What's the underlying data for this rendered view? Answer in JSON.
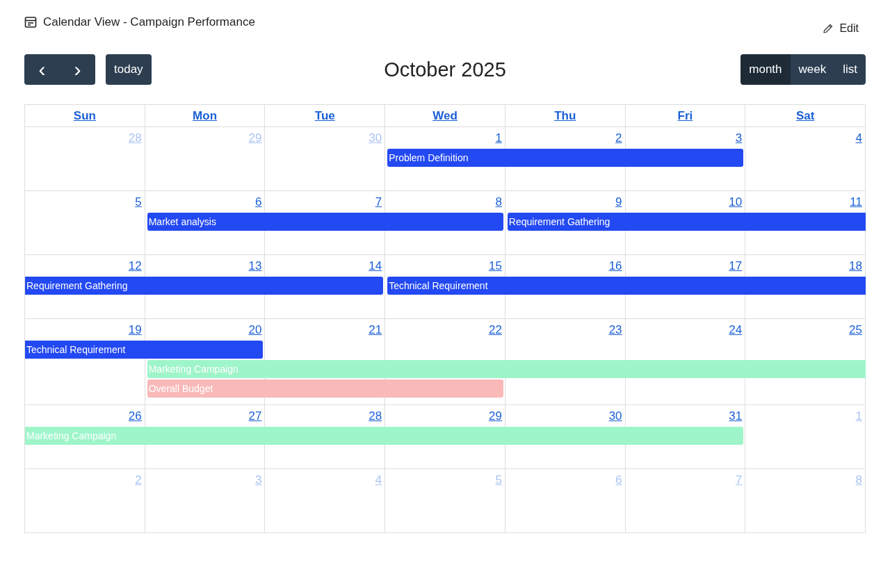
{
  "header": {
    "title": "Calendar View - Campaign Performance",
    "edit_label": "Edit"
  },
  "toolbar": {
    "prev": "‹",
    "next": "›",
    "today": "today",
    "title": "October 2025",
    "views": [
      {
        "label": "month",
        "selected": true
      },
      {
        "label": "week",
        "selected": false
      },
      {
        "label": "list",
        "selected": false
      }
    ]
  },
  "weekdays": [
    "Sun",
    "Mon",
    "Tue",
    "Wed",
    "Thu",
    "Fri",
    "Sat"
  ],
  "weeks": [
    {
      "days": [
        {
          "number": "28",
          "other_month": true
        },
        {
          "number": "29",
          "other_month": true
        },
        {
          "number": "30",
          "other_month": true
        },
        {
          "number": "1",
          "other_month": false
        },
        {
          "number": "2",
          "other_month": false
        },
        {
          "number": "3",
          "other_month": false
        },
        {
          "number": "4",
          "other_month": false
        }
      ],
      "events": [
        {
          "title": "Problem Definition",
          "covers": [
            false,
            false,
            false,
            true,
            true,
            true,
            false
          ],
          "color": "#2349f2",
          "continues_before": false,
          "continues_after": false
        }
      ]
    },
    {
      "days": [
        {
          "number": "5",
          "other_month": false
        },
        {
          "number": "6",
          "other_month": false
        },
        {
          "number": "7",
          "other_month": false
        },
        {
          "number": "8",
          "other_month": false
        },
        {
          "number": "9",
          "other_month": false
        },
        {
          "number": "10",
          "other_month": false
        },
        {
          "number": "11",
          "other_month": false
        }
      ],
      "events": [
        {
          "title": "Market analysis",
          "covers": [
            false,
            true,
            true,
            true,
            false,
            false,
            false
          ],
          "color": "#2349f2",
          "continues_before": false,
          "continues_after": false
        },
        {
          "title": "Requirement Gathering",
          "covers": [
            false,
            false,
            false,
            false,
            true,
            true,
            true
          ],
          "color": "#2349f2",
          "continues_before": false,
          "continues_after": true
        }
      ]
    },
    {
      "days": [
        {
          "number": "12",
          "other_month": false
        },
        {
          "number": "13",
          "other_month": false
        },
        {
          "number": "14",
          "other_month": false
        },
        {
          "number": "15",
          "other_month": false
        },
        {
          "number": "16",
          "other_month": false
        },
        {
          "number": "17",
          "other_month": false
        },
        {
          "number": "18",
          "other_month": false
        }
      ],
      "events": [
        {
          "title": "Requirement Gathering",
          "covers": [
            true,
            true,
            true,
            false,
            false,
            false,
            false
          ],
          "color": "#2349f2",
          "continues_before": true,
          "continues_after": false
        },
        {
          "title": "Technical Requirement",
          "covers": [
            false,
            false,
            false,
            true,
            true,
            true,
            true
          ],
          "color": "#2349f2",
          "continues_before": false,
          "continues_after": true
        }
      ]
    },
    {
      "days": [
        {
          "number": "19",
          "other_month": false
        },
        {
          "number": "20",
          "other_month": false
        },
        {
          "number": "21",
          "other_month": false
        },
        {
          "number": "22",
          "other_month": false
        },
        {
          "number": "23",
          "other_month": false
        },
        {
          "number": "24",
          "other_month": false
        },
        {
          "number": "25",
          "other_month": false
        }
      ],
      "events": [
        {
          "title": "Technical Requirement",
          "covers": [
            true,
            true,
            false,
            false,
            false,
            false,
            false
          ],
          "color": "#2349f2",
          "continues_before": true,
          "continues_after": false
        },
        {
          "title": "Marketing Campaign",
          "covers": [
            false,
            true,
            true,
            true,
            true,
            true,
            true
          ],
          "color": "#9ef5c9",
          "continues_before": false,
          "continues_after": true
        },
        {
          "title": "Overall Budget",
          "covers": [
            false,
            true,
            true,
            true,
            false,
            false,
            false
          ],
          "color": "#f9b9b9",
          "continues_before": false,
          "continues_after": false
        }
      ]
    },
    {
      "days": [
        {
          "number": "26",
          "other_month": false
        },
        {
          "number": "27",
          "other_month": false
        },
        {
          "number": "28",
          "other_month": false
        },
        {
          "number": "29",
          "other_month": false
        },
        {
          "number": "30",
          "other_month": false
        },
        {
          "number": "31",
          "other_month": false
        },
        {
          "number": "1",
          "other_month": true
        }
      ],
      "events": [
        {
          "title": "Marketing Campaign",
          "covers": [
            true,
            true,
            true,
            true,
            true,
            true,
            false
          ],
          "color": "#9ef5c9",
          "continues_before": true,
          "continues_after": false
        }
      ]
    },
    {
      "days": [
        {
          "number": "2",
          "other_month": true
        },
        {
          "number": "3",
          "other_month": true
        },
        {
          "number": "4",
          "other_month": true
        },
        {
          "number": "5",
          "other_month": true
        },
        {
          "number": "6",
          "other_month": true
        },
        {
          "number": "7",
          "other_month": true
        },
        {
          "number": "8",
          "other_month": true
        }
      ]
    }
  ]
}
